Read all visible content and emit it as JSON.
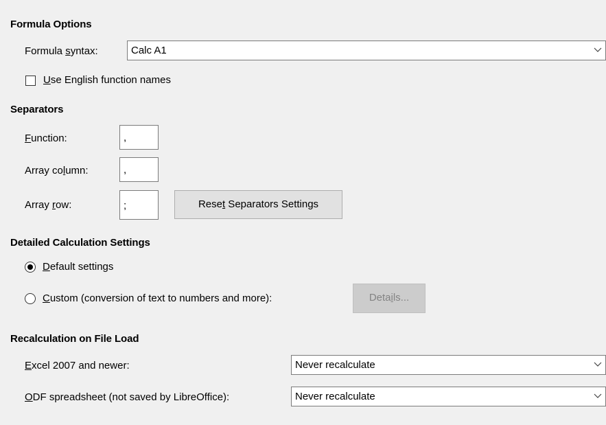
{
  "formula_options": {
    "title": "Formula Options",
    "syntax_label_pre": "Formula ",
    "syntax_label_acc": "s",
    "syntax_label_post": "yntax:",
    "syntax_value": "Calc A1",
    "english_names_acc": "U",
    "english_names_post": "se English function names",
    "english_names_checked": false
  },
  "separators": {
    "title": "Separators",
    "function_label_acc": "F",
    "function_label_post": "unction:",
    "function_value": ",",
    "array_column_label_pre": "Array co",
    "array_column_label_acc": "l",
    "array_column_label_post": "umn:",
    "array_column_value": ",",
    "array_row_label_pre": "Array ",
    "array_row_label_acc": "r",
    "array_row_label_post": "ow:",
    "array_row_value": ";",
    "reset_button_pre": "Rese",
    "reset_button_acc": "t",
    "reset_button_post": " Separators Settings"
  },
  "detailed_calc": {
    "title": "Detailed Calculation Settings",
    "default_acc": "D",
    "default_post": "efault settings",
    "default_selected": true,
    "custom_acc": "C",
    "custom_post": "ustom (conversion of text to numbers and more):",
    "custom_selected": false,
    "details_button_pre": "Deta",
    "details_button_acc": "i",
    "details_button_post": "ls..."
  },
  "recalc": {
    "title": "Recalculation on File Load",
    "excel_label_acc": "E",
    "excel_label_post": "xcel 2007 and newer:",
    "excel_value": "Never recalculate",
    "odf_label_acc": "O",
    "odf_label_post": "DF spreadsheet (not saved by LibreOffice):",
    "odf_value": "Never recalculate"
  },
  "icons": {
    "dropdown": "chevron-down-icon"
  },
  "colors": {
    "background": "#f0f0f0",
    "field_border": "#7a7a7a",
    "button_bg": "#e1e1e1",
    "disabled_text": "#838383"
  }
}
